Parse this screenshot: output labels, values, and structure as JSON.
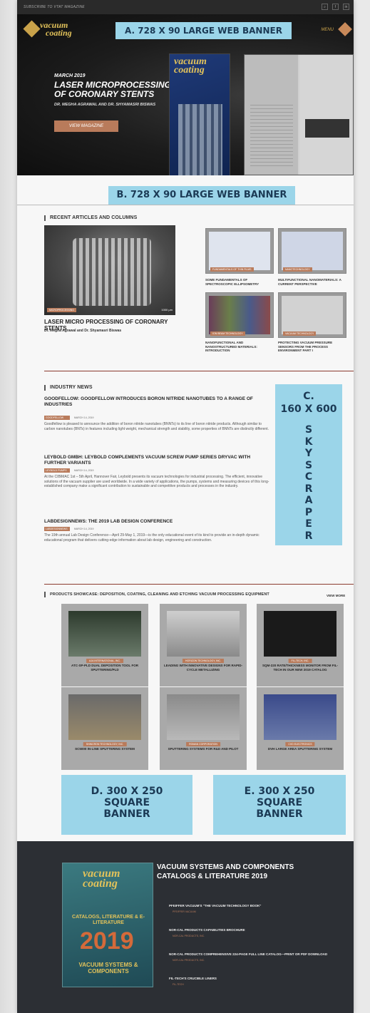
{
  "topbar": {
    "subscribe": "SUBSCRIBE TO VTAT MAGAZINE"
  },
  "logo": {
    "line1": "vacuum",
    "line2": "coating"
  },
  "nav": {
    "menu": "MENU"
  },
  "ads": {
    "a": "A. 728 X 90 LARGE WEB BANNER",
    "b": "B. 728 X 90 LARGE WEB BANNER",
    "c_line1": "C.",
    "c_line2": "160 X 600",
    "c_letters": [
      "S",
      "K",
      "Y",
      "S",
      "C",
      "R",
      "A",
      "P",
      "E",
      "R"
    ],
    "d_line1": "D.  300 X 250",
    "d_line2": "SQUARE",
    "d_line3": "BANNER",
    "e_line1": "E.  300 X 250",
    "e_line2": "SQUARE",
    "e_line3": "BANNER"
  },
  "hero": {
    "date": "MARCH 2019",
    "title": "LASER MICROPROCESSING OF CORONARY STENTS",
    "authors": "DR. MEGHA AGRAWAL AND DR. SHYAMASRI BISWAS",
    "button": "VIEW MAGAZINE"
  },
  "recent": {
    "heading": "RECENT ARTICLES AND COLUMNS",
    "featured": {
      "tag": "MICROPROCESSING",
      "scale": "1000 μm",
      "title": "LASER MICRO PROCESSING OF CORONARY STENTS",
      "authors": "Dr. Megha Agrawal and Dr. Shyamasri Biswas"
    },
    "items": [
      {
        "tag": "FUNDAMENTALS OF THIN FILMS",
        "title": "SOME FUNDAMENTALS OF SPECTROSCOPIC ELLIPSOMETRY"
      },
      {
        "tag": "NANOTECHNOLOGY",
        "title": "MULTIFUNCTIONAL NANOMATERIALS: A CURRENT PERSPECTIVE"
      },
      {
        "tag": "ION BEAM TECHNOLOGY",
        "title": "NANOFUNCTIONAL AND NANOSTRUCTURED MATERIALS: INTRODUCTION"
      },
      {
        "tag": "VACUUM TECHNOLOGY",
        "title": "PROTECTING VACUUM PRESSURE SENSORS FROM THE PROCESS ENVIRONMENT PART I"
      }
    ]
  },
  "news": {
    "heading": "INDUSTRY NEWS",
    "items": [
      {
        "title": "GOODFELLOW: GOODFELLOW INTRODUCES BORON NITRIDE NANOTUBES TO A RANGE OF INDUSTRIES",
        "tag": "GOODFELLOW",
        "date": "MARCH 14, 2019",
        "body": "Goodfellow is pleased to announce the addition of boron nitride nanotubes (BNNTs) to its line of boron nitride products. Although similar to carbon nanotubes (BNTs) in features including light weight, mechanical strength and stability, some properties of BNNTs are distinctly different."
      },
      {
        "title": "LEYBOLD GMBH: LEYBOLD COMPLEMENTS VACUUM SCREW PUMP SERIES DRYVAC WITH FURTHER VARIANTS",
        "tag": "LEYBOLD PUMPS",
        "date": "MARCH 14, 2019",
        "body": "At the CIBIMAC 1st – 5th April, Hannover Fair, Leybold presents its vacuum technologies for industrial processing. The efficient, innovative solutions of the vacuum supplier are used worldwide. In a wide variety of applications, the pumps, systems and measuring devices of this long-established company make a significant contribution to sustainable and competitive products and processes in the industry."
      },
      {
        "title": "LABDESIGNNEWS: THE 2019 LAB DESIGN CONFERENCE",
        "tag": "LABDESIGNNEWS",
        "date": "MARCH 14, 2019",
        "body": "The 19th annual Lab Design Conference—April 29-May 1, 2019—is the only educational event of its kind to provide an in-depth dynamic educational program that delivers cutting-edge information about lab design, engineering and construction."
      }
    ]
  },
  "products": {
    "heading": "PRODUCTS SHOWCASE: DEPOSITION, COATING, CLEANING AND ETCHING VACUUM PROCESSING EQUIPMENT",
    "view_more": "VIEW MORE",
    "items": [
      {
        "tag": "AJA INTERNATIONAL, INC.",
        "title": "ATC-SP-PLD DUAL DEPOSITION TOOL FOR SPUTTERING/PLD"
      },
      {
        "tag": "HORIZON TECHNOLOGY, INC.",
        "title": "LEADING WITH INNOVATIVE DESIGNS FOR RAPID-CYCLE METALLIZING"
      },
      {
        "tag": "FIL-TECH, INC.",
        "title": "SQM-220 RATE/THICKNESS MONITOR FROM FIL-TECH IN OUR NEW 2019 CATALOG"
      },
      {
        "tag": "SHINCRON TECHNOLOGY, INC.",
        "title": "SC5000 IN-LINE SPUTTERING SYSTEM"
      },
      {
        "tag": "ROMAN CORPORATION",
        "title": "SPUTTERING SYSTEMS FOR R&D AND PILOT"
      },
      {
        "tag": "CVD ELECTRONICS",
        "title": "DVH LARGE AREA SPUTTERING SYSTEM"
      }
    ]
  },
  "footer": {
    "title": "VACUUM SYSTEMS AND COMPONENTS CATALOGS & LITERATURE 2019",
    "book": {
      "line1": "vacuum",
      "line2": "coating",
      "sub1": "CATALOGS, LITERATURE & E-LITERATURE",
      "year": "2019",
      "sub2": "VACUUM SYSTEMS & COMPONENTS"
    },
    "items": [
      {
        "title": "PFEIFFER VACUUM'S \"THE VACUUM TECHNOLOGY BOOK\"",
        "sub": "PFEIFFER VACUUM"
      },
      {
        "title": "NOR-CAL PRODUCTS CAPABILITIES BROCHURE",
        "sub": "NOR-CAL PRODUCTS, INC."
      },
      {
        "title": "NOR-CAL PRODUCTS COMPREHENSIVE 224-PAGE FULL LINE CATALOG—PRINT OR PDF DOWNLOAD",
        "sub": "NOR-CAL PRODUCTS, INC."
      },
      {
        "title": "FIL-TECH'S CRUCIBLE LINERS",
        "sub": "FIL-TECH"
      }
    ]
  }
}
